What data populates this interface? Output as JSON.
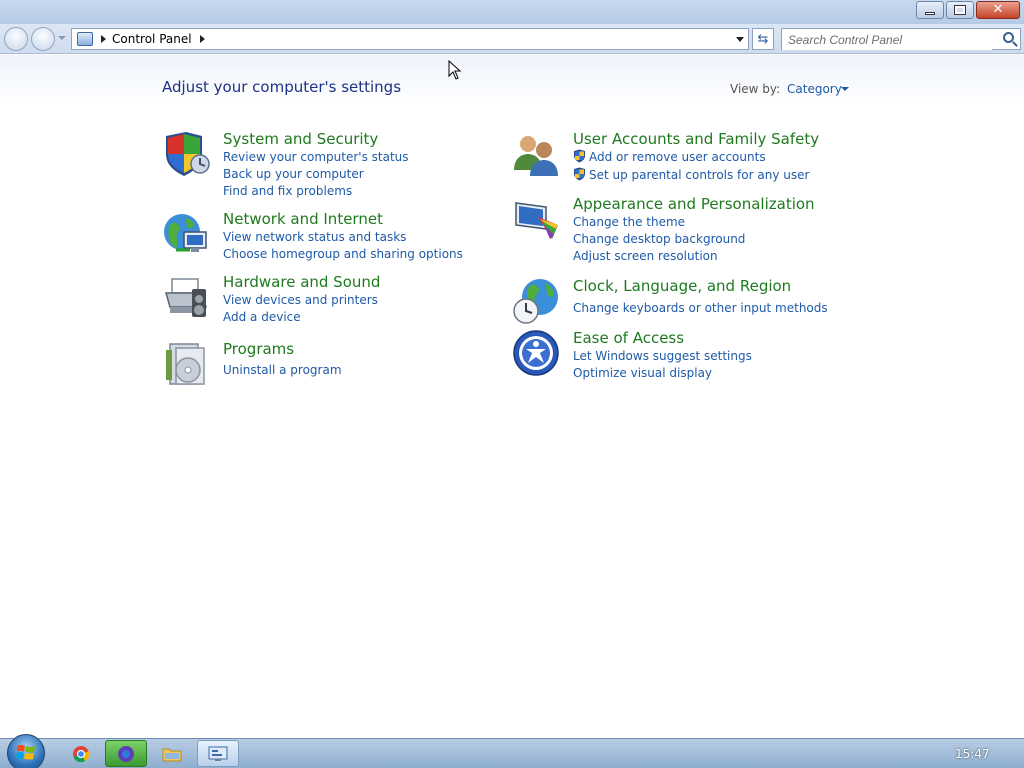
{
  "window": {
    "minimize_icon": "minimize-icon",
    "restore_icon": "restore-icon",
    "close_icon": "close-icon"
  },
  "address_bar": {
    "breadcrumb": "Control Panel",
    "search_placeholder": "Search Control Panel"
  },
  "header": {
    "title": "Adjust your computer's settings",
    "view_by_label": "View by:",
    "view_by_value": "Category"
  },
  "categories": [
    {
      "title": "System and Security",
      "icon": "shield-icon",
      "links": [
        "Review your computer's status",
        "Back up your computer",
        "Find and fix problems"
      ]
    },
    {
      "title": "Network and Internet",
      "icon": "network-globe-icon",
      "links": [
        "View network status and tasks",
        "Choose homegroup and sharing options"
      ]
    },
    {
      "title": "Hardware and Sound",
      "icon": "printer-speaker-icon",
      "links": [
        "View devices and printers",
        "Add a device"
      ]
    },
    {
      "title": "Programs",
      "icon": "programs-disc-icon",
      "links": [
        "Uninstall a program"
      ]
    },
    {
      "title": "User Accounts and Family Safety",
      "icon": "users-icon",
      "links": [
        "Add or remove user accounts",
        "Set up parental controls for any user"
      ]
    },
    {
      "title": "Appearance and Personalization",
      "icon": "monitor-palette-icon",
      "links": [
        "Change the theme",
        "Change desktop background",
        "Adjust screen resolution"
      ]
    },
    {
      "title": "Clock, Language, and Region",
      "icon": "globe-clock-icon",
      "links": [
        "Change keyboards or other input methods"
      ]
    },
    {
      "title": "Ease of Access",
      "icon": "ease-of-access-icon",
      "links": [
        "Let Windows suggest settings",
        "Optimize visual display"
      ]
    }
  ],
  "taskbar": {
    "clock": "15:47"
  },
  "colors": {
    "category_title": "#1e7a1e",
    "link": "#1e5aa8",
    "page_title": "#1e3287"
  }
}
